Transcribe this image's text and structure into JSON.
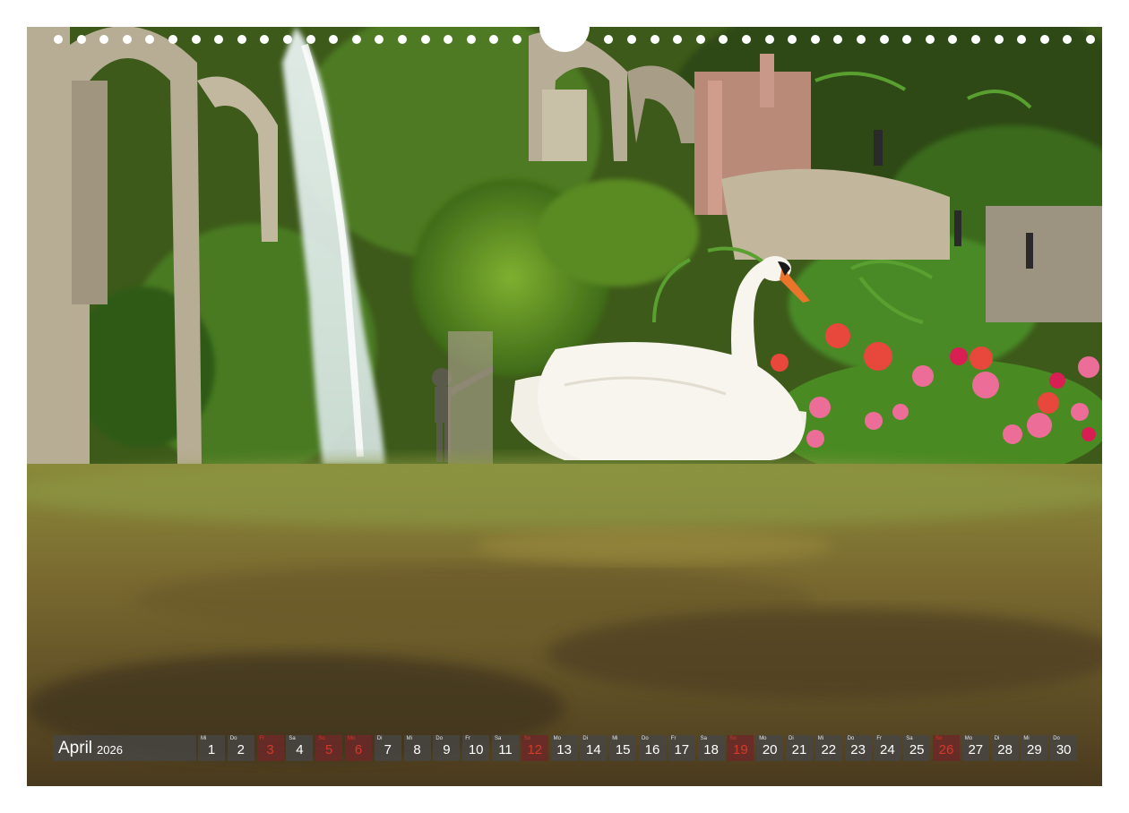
{
  "calendar": {
    "month": "April",
    "year": "2026",
    "days": [
      {
        "num": "1",
        "dow": "Mi",
        "holiday": false
      },
      {
        "num": "2",
        "dow": "Do",
        "holiday": false
      },
      {
        "num": "3",
        "dow": "Fr",
        "holiday": true
      },
      {
        "num": "4",
        "dow": "Sa",
        "holiday": false
      },
      {
        "num": "5",
        "dow": "So",
        "holiday": true
      },
      {
        "num": "6",
        "dow": "Mo",
        "holiday": true
      },
      {
        "num": "7",
        "dow": "Di",
        "holiday": false
      },
      {
        "num": "8",
        "dow": "Mi",
        "holiday": false
      },
      {
        "num": "9",
        "dow": "Do",
        "holiday": false
      },
      {
        "num": "10",
        "dow": "Fr",
        "holiday": false
      },
      {
        "num": "11",
        "dow": "Sa",
        "holiday": false
      },
      {
        "num": "12",
        "dow": "So",
        "holiday": true
      },
      {
        "num": "13",
        "dow": "Mo",
        "holiday": false
      },
      {
        "num": "14",
        "dow": "Di",
        "holiday": false
      },
      {
        "num": "15",
        "dow": "Mi",
        "holiday": false
      },
      {
        "num": "16",
        "dow": "Do",
        "holiday": false
      },
      {
        "num": "17",
        "dow": "Fr",
        "holiday": false
      },
      {
        "num": "18",
        "dow": "Sa",
        "holiday": false
      },
      {
        "num": "19",
        "dow": "So",
        "holiday": true
      },
      {
        "num": "20",
        "dow": "Mo",
        "holiday": false
      },
      {
        "num": "21",
        "dow": "Di",
        "holiday": false
      },
      {
        "num": "22",
        "dow": "Mi",
        "holiday": false
      },
      {
        "num": "23",
        "dow": "Do",
        "holiday": false
      },
      {
        "num": "24",
        "dow": "Fr",
        "holiday": false
      },
      {
        "num": "25",
        "dow": "Sa",
        "holiday": false
      },
      {
        "num": "26",
        "dow": "So",
        "holiday": true
      },
      {
        "num": "27",
        "dow": "Mo",
        "holiday": false
      },
      {
        "num": "28",
        "dow": "Di",
        "holiday": false
      },
      {
        "num": "29",
        "dow": "Mi",
        "holiday": false
      },
      {
        "num": "30",
        "dow": "Do",
        "holiday": false
      }
    ]
  },
  "colors": {
    "day_cell": "#464646",
    "holiday_text": "#d23a2a",
    "page_background": "#ffffff"
  }
}
